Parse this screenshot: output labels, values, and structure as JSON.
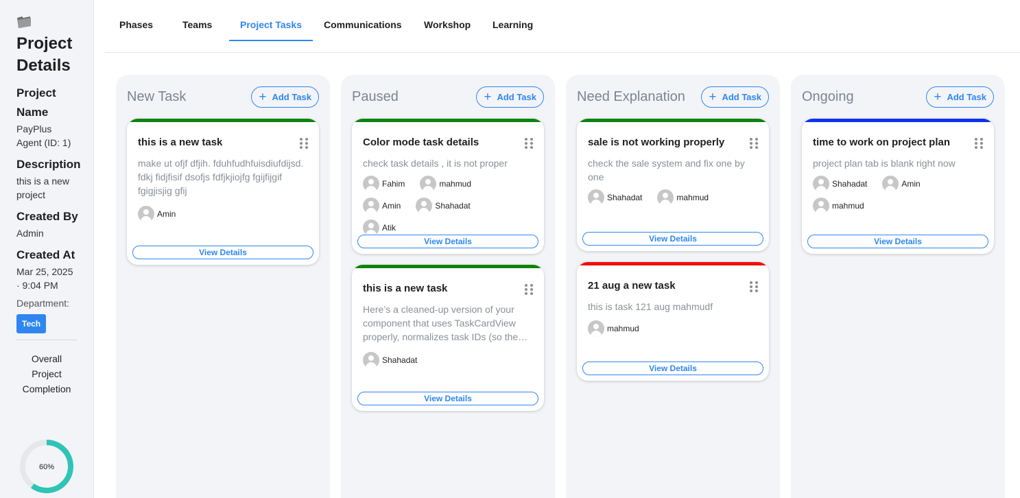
{
  "sidebar": {
    "title_line1": "Project",
    "title_line2": "Details",
    "project_name_label_1": "Project",
    "project_name_label_2": "Name",
    "project_name_line1": "PayPlus",
    "project_name_line2": "Agent (ID: 1)",
    "description_label": "Description",
    "description_line1": "this is a new",
    "description_line2": "project",
    "created_by_label": "Created By",
    "created_by": "Admin",
    "created_at_label": "Created At",
    "created_at_line1": "Mar 25, 2025",
    "created_at_line2": "· 9:04 PM",
    "department_label": "Department:",
    "department": "Tech",
    "completion_line1": "Overall",
    "completion_line2": "Project",
    "completion_line3": "Completion",
    "completion_percent": "60%",
    "completion_value": 0.6,
    "completion_color": "#2ec4b6"
  },
  "tabs": {
    "phases": "Phases",
    "teams": "Teams",
    "project_tasks": "Project Tasks",
    "communications": "Communications",
    "workshop": "Workshop",
    "learning": "Learning",
    "active": "Project Tasks"
  },
  "common": {
    "add_task": "Add Task",
    "view_details": "View Details"
  },
  "columns": {
    "new_task": {
      "title": "New Task",
      "card1": {
        "title": "this is a new task",
        "desc_line1": "make ut ofjf dfjih. fduhfudhfuisdiufdijsd.",
        "desc_line2": "fdkj fidjfisif dsofjs fdfjkjiojfg fgijfijgif",
        "desc_line3": "fgigjisjig gfij",
        "assignee1": "Amin",
        "bar_color": "#108210"
      }
    },
    "paused": {
      "title": "Paused",
      "card1": {
        "title": "Color mode task details",
        "desc": "check task details , it is not proper",
        "assignee1": "Fahim",
        "assignee2": "mahmud",
        "assignee3": "Amin",
        "assignee4": "Shahadat",
        "assignee5": "Atik",
        "bar_color": "#108210"
      },
      "card2": {
        "title": "this is a new task",
        "desc_line1": "Here’s a cleaned-up version of your",
        "desc_line2": "component that uses TaskCardView",
        "desc_line3": "properly, normalizes task IDs (so the…",
        "assignee1": "Shahadat",
        "bar_color": "#108210"
      }
    },
    "need_explanation": {
      "title": "Need Explanation",
      "card1": {
        "title": "sale is not working properly",
        "desc_line1": "check the sale system and fix one by",
        "desc_line2": "one",
        "assignee1": "Shahadat",
        "assignee2": "mahmud",
        "bar_color": "#108210"
      },
      "card2": {
        "title": "21 aug a new task",
        "desc": "this is task 121 aug mahmudf",
        "assignee1": "mahmud",
        "bar_color": "#f10f0f"
      }
    },
    "ongoing": {
      "title": "Ongoing",
      "card1": {
        "title": "time to work on project plan",
        "desc": "project plan tab is blank right now",
        "assignee1": "Shahadat",
        "assignee2": "Amin",
        "assignee3": "mahmud",
        "bar_color": "#0b32f0"
      }
    }
  }
}
